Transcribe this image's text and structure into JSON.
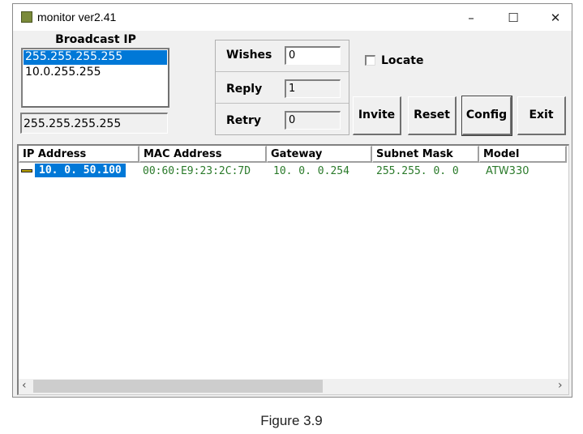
{
  "window": {
    "title": "monitor ver2.41",
    "minimize": "–",
    "maximize": "☐",
    "close": "✕"
  },
  "broadcast": {
    "label": "Broadcast IP",
    "items": [
      "255.255.255.255",
      "10.0.255.255"
    ],
    "selected_index": 0,
    "edit_value": "255.255.255.255"
  },
  "counters": [
    {
      "label": "Wishes",
      "value": "0"
    },
    {
      "label": "Reply",
      "value": "1"
    },
    {
      "label": "Retry",
      "value": "0"
    }
  ],
  "locate": {
    "label": "Locate",
    "checked": false
  },
  "buttons": {
    "invite": "Invite",
    "reset": "Reset",
    "config": "Config",
    "exit": "Exit"
  },
  "table": {
    "columns": [
      "IP Address",
      "MAC Address",
      "Gateway",
      "Subnet Mask",
      "Model"
    ],
    "rows": [
      {
        "ip": "10. 0. 50.100",
        "mac": "00:60:E9:23:2C:7D",
        "gateway": "10. 0. 0.254",
        "subnet": "255.255. 0. 0",
        "model": "ATW330"
      }
    ]
  },
  "scroll": {
    "left": "‹",
    "right": "›",
    "position_fraction": 0.0,
    "visible_fraction": 0.53
  },
  "caption": "Figure 3.9"
}
